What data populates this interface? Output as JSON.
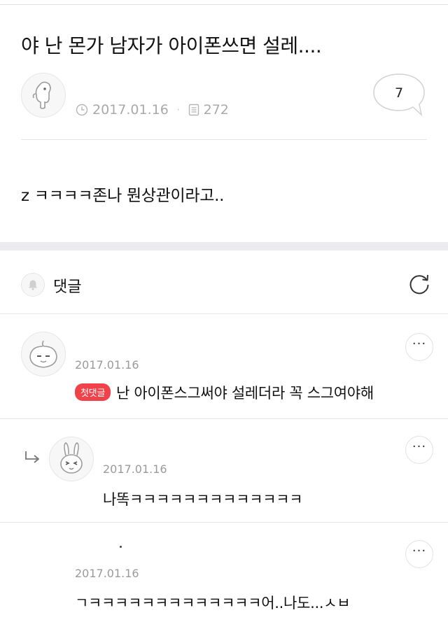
{
  "post": {
    "title": "야 난 몬가 남자가 아이폰쓰면 설레....",
    "date": "2017.01.16",
    "views": "272",
    "comment_count": "7",
    "body": "z ㅋㅋㅋㅋ존나 뭔상관이라고.."
  },
  "comments_section": {
    "label": "댓글"
  },
  "comments": [
    {
      "date": "2017.01.16",
      "badge": "첫댓글",
      "text": "난 아이폰스그써야 설레더라 꼭 스그여야해",
      "more": "···"
    },
    {
      "date": "2017.01.16",
      "text": "나똑ㅋㅋㅋㅋㅋㅋㅋㅋㅋㅋㅋㅋㅋ",
      "more": "···"
    },
    {
      "date": "2017.01.16",
      "text": "ㄱㅋㅋㅋㅋㅋㅋㅋㅋㅋㅋㅋㅋㅋ어..나도...ㅅㅂ",
      "more": "···"
    }
  ]
}
